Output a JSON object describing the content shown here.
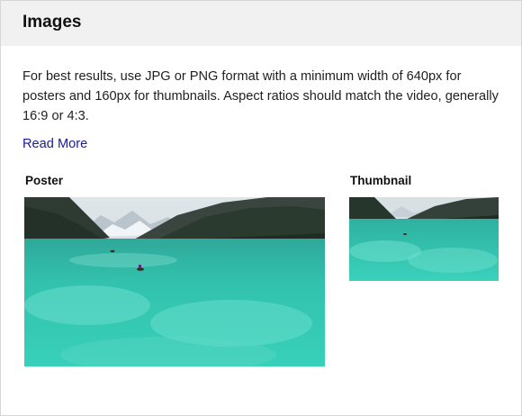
{
  "header": {
    "title": "Images"
  },
  "description": "For best results, use JPG or PNG format with a minimum width of 640px for posters and 160px for thumbnails. Aspect ratios should match the video, generally 16:9 or 4:3.",
  "read_more_label": "Read More",
  "poster": {
    "label": "Poster"
  },
  "thumbnail": {
    "label": "Thumbnail"
  },
  "colors": {
    "header_bg": "#f1f1f1",
    "link": "#1a1a9a",
    "lake": "#2ec7b2",
    "border": "#d6d6d6"
  }
}
